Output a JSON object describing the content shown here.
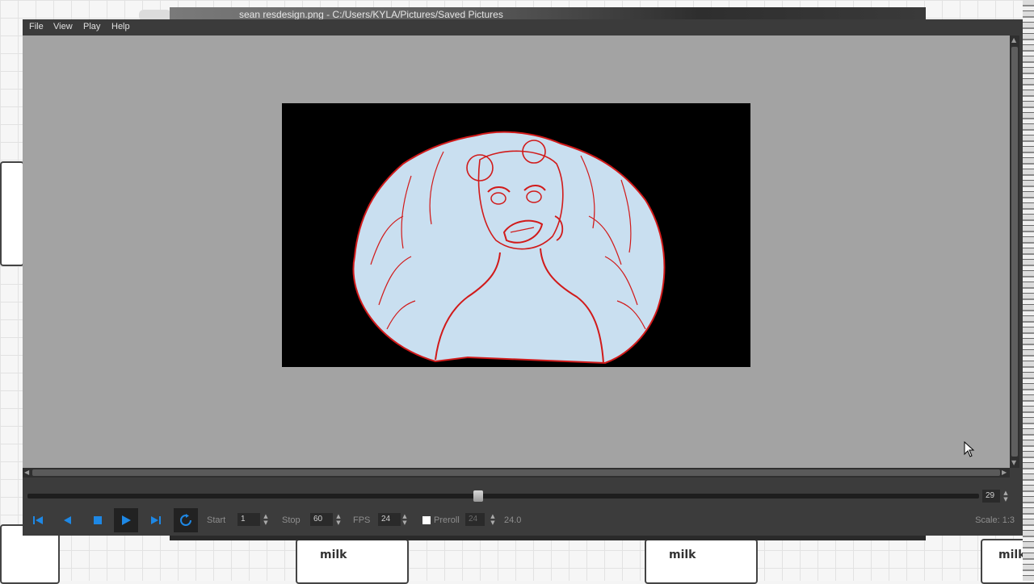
{
  "window": {
    "title": "sean resdesign.png - C:/Users/KYLA/Pictures/Saved Pictures"
  },
  "menu": {
    "items": [
      "File",
      "View",
      "Play",
      "Help"
    ]
  },
  "playback": {
    "current_frame": "29",
    "start_label": "Start",
    "start_value": "1",
    "stop_label": "Stop",
    "stop_value": "60",
    "fps_label": "FPS",
    "fps_value": "24",
    "preroll_label": "Preroll",
    "preroll_value": "24",
    "actual_fps": "24.0",
    "scale_label": "Scale: 1:3",
    "progress_fraction": 0.48
  },
  "background": {
    "carton_text": "milk"
  },
  "colors": {
    "accent": "#1e88e5",
    "sketch_line": "#d11a1a",
    "sketch_fill": "#c9dff0"
  }
}
